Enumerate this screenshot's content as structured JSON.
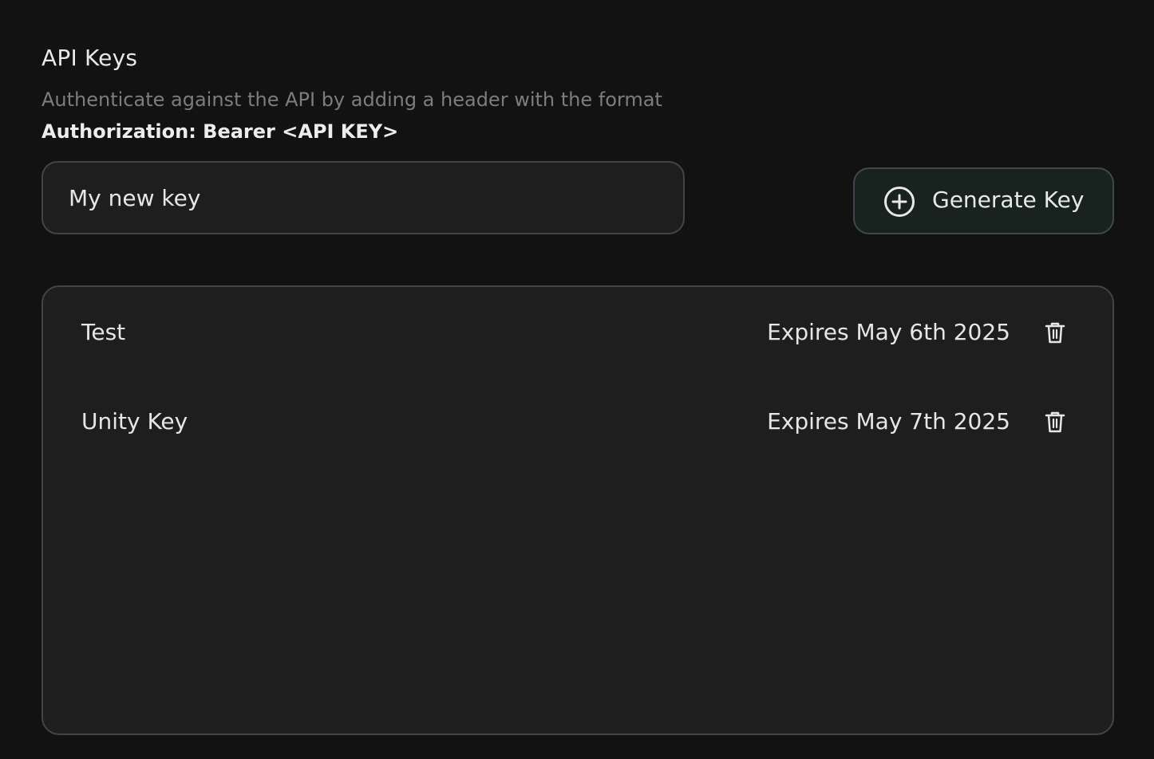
{
  "section": {
    "title": "API Keys",
    "description": "Authenticate against the API by adding a header with the format",
    "auth_format": "Authorization: Bearer <API KEY>"
  },
  "new_key": {
    "value": "My new key",
    "placeholder": ""
  },
  "generate_button": {
    "label": "Generate Key",
    "icon": "plus-circle-icon"
  },
  "keys": [
    {
      "name": "Test",
      "expires": "Expires May 6th 2025",
      "delete_icon": "trash-icon"
    },
    {
      "name": "Unity Key",
      "expires": "Expires May 7th 2025",
      "delete_icon": "trash-icon"
    }
  ],
  "colors": {
    "background": "#121212",
    "panel": "#1e1e1e",
    "border": "#40444b",
    "button_bg": "#18221e",
    "text": "#e6e6e6",
    "muted_text": "#7d7d7d"
  }
}
